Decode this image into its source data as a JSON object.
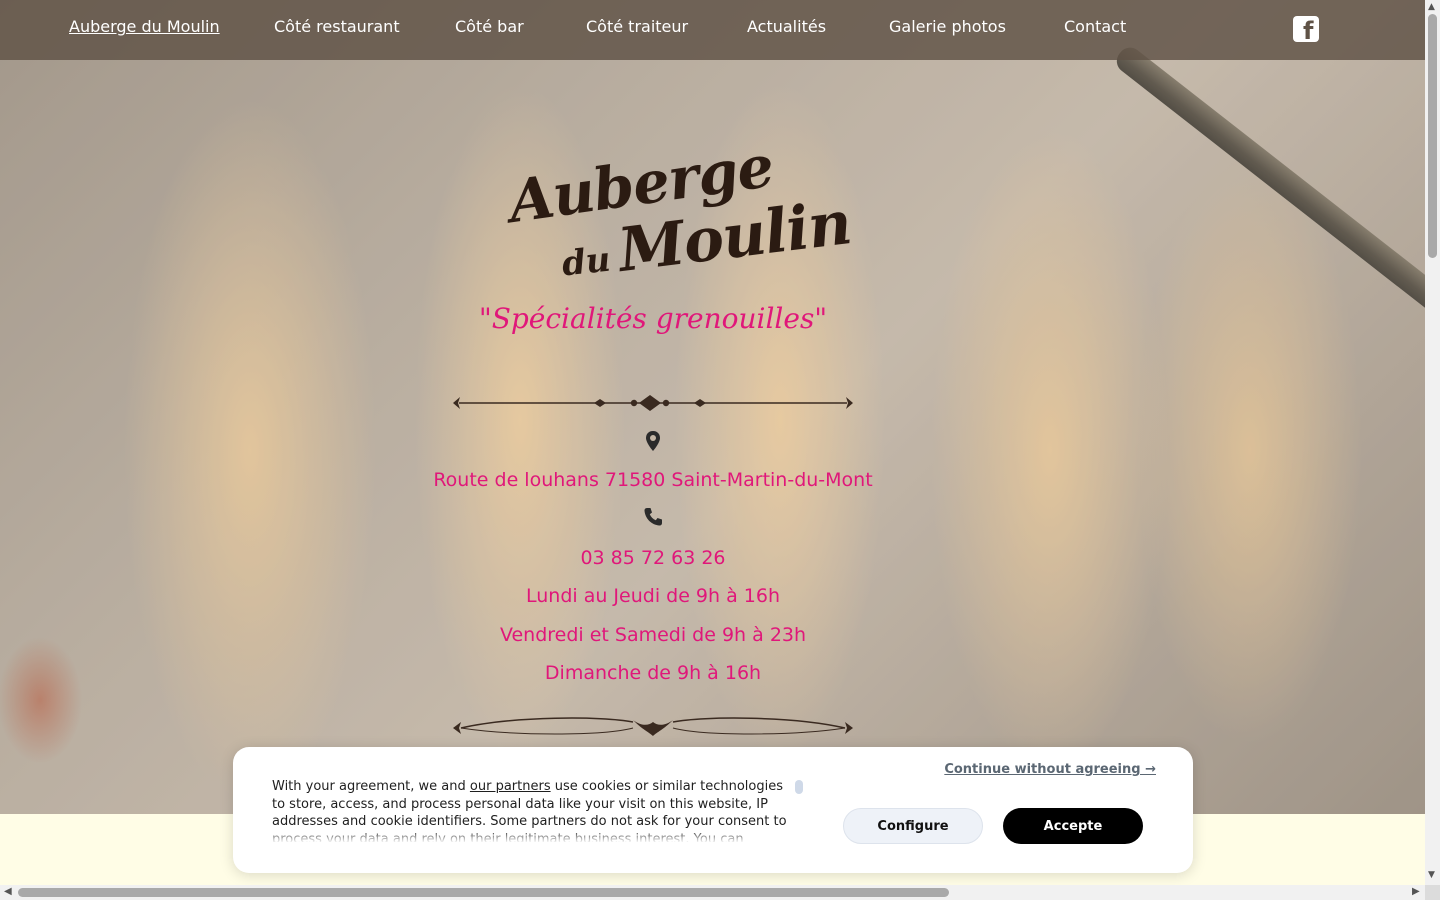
{
  "nav": {
    "items": [
      {
        "label": "Auberge du Moulin",
        "active": true
      },
      {
        "label": "Côté restaurant"
      },
      {
        "label": "Côté bar"
      },
      {
        "label": "Côté traiteur"
      },
      {
        "label": "Actualités"
      },
      {
        "label": "Galerie photos"
      },
      {
        "label": "Contact"
      }
    ],
    "social_icon": "facebook-icon"
  },
  "hero": {
    "logo": {
      "line1": "Auberge",
      "line2": "du",
      "line3": "Moulin"
    },
    "tagline": "\"Spécialités grenouilles\"",
    "address": "Route de louhans 71580 Saint-Martin-du-Mont",
    "phone": "03 85 72 63 26",
    "hours": [
      "Lundi au Jeudi de 9h à 16h",
      "Vendredi et Samedi de 9h à 23h",
      "Dimanche de 9h à 16h"
    ],
    "icons": {
      "address": "map-pin-icon",
      "phone": "phone-icon"
    }
  },
  "cookie_banner": {
    "text_before": "With your agreement, we and",
    "partners_link": "our partners",
    "text_after": "use cookies or similar technologies to store, access, and process personal data like your visit on this website, IP addresses and cookie identifiers. Some partners do not ask for your consent to process your data and rely on their legitimate business interest. You can",
    "continue_label": "Continue without agreeing →",
    "configure_label": "Configure",
    "accept_label": "Accepte"
  },
  "colors": {
    "accent": "#e0177a",
    "nav_bg": "#5f5246",
    "logo": "#2b1b12",
    "page_bg": "#fffde6"
  }
}
